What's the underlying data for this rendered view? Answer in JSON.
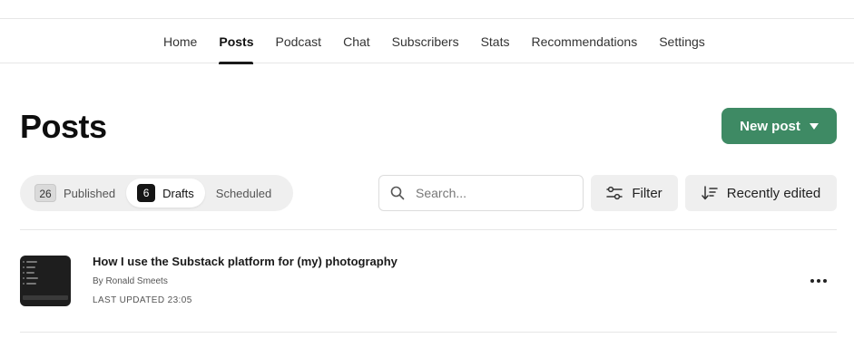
{
  "nav": {
    "items": [
      {
        "label": "Home"
      },
      {
        "label": "Posts",
        "active": true
      },
      {
        "label": "Podcast"
      },
      {
        "label": "Chat"
      },
      {
        "label": "Subscribers"
      },
      {
        "label": "Stats"
      },
      {
        "label": "Recommendations"
      },
      {
        "label": "Settings"
      }
    ]
  },
  "page": {
    "title": "Posts",
    "new_post_label": "New post"
  },
  "tabs": {
    "published": {
      "count": "26",
      "label": "Published"
    },
    "drafts": {
      "count": "6",
      "label": "Drafts",
      "active": true
    },
    "scheduled": {
      "label": "Scheduled"
    }
  },
  "toolbar": {
    "search_placeholder": "Search...",
    "filter_label": "Filter",
    "sort_label": "Recently edited"
  },
  "posts": [
    {
      "title": "How I use the Substack platform for (my) photography",
      "author": "By Ronald Smeets",
      "updated": "LAST UPDATED 23:05"
    }
  ],
  "colors": {
    "accent": "#3e8a64"
  }
}
